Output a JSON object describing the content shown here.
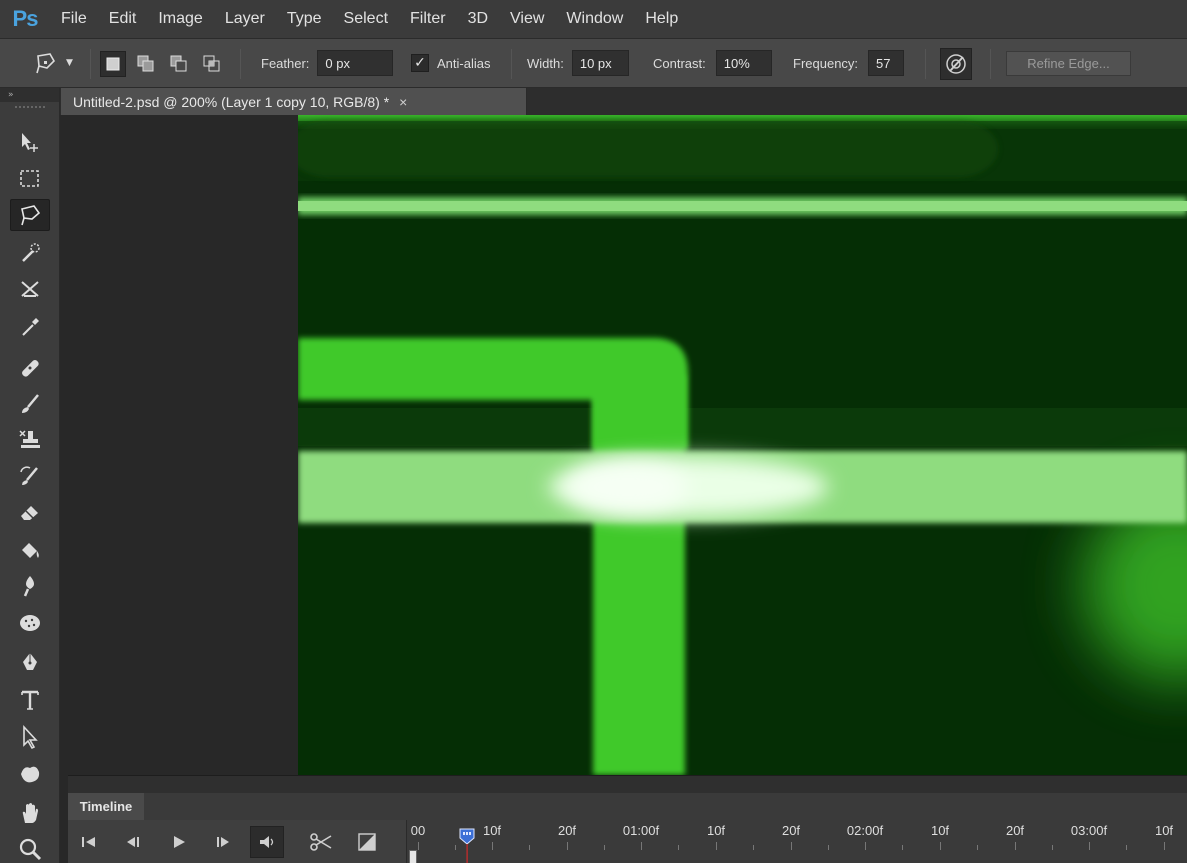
{
  "app": {
    "logo": "Ps"
  },
  "menu": [
    "File",
    "Edit",
    "Image",
    "Layer",
    "Type",
    "Select",
    "Filter",
    "3D",
    "View",
    "Window",
    "Help"
  ],
  "options": {
    "tool_icon": "magnetic-lasso-icon",
    "feather_label": "Feather:",
    "feather_value": "0 px",
    "antialias_label": "Anti-alias",
    "antialias_checked": true,
    "width_label": "Width:",
    "width_value": "10 px",
    "contrast_label": "Contrast:",
    "contrast_value": "10%",
    "frequency_label": "Frequency:",
    "frequency_value": "57",
    "refine_edge_label": "Refine Edge..."
  },
  "toolpanel": {
    "collapse_label": "»"
  },
  "document": {
    "tab_title": "Untitled-2.psd @ 200% (Layer 1 copy 10, RGB/8) *",
    "close_glyph": "×"
  },
  "timeline": {
    "tab_label": "Timeline",
    "ruler_labels": [
      "00",
      "10f",
      "20f",
      "01:00f",
      "10f",
      "20f",
      "02:00f",
      "10f",
      "20f",
      "03:00f",
      "10f"
    ],
    "current_frame": "10f"
  },
  "colors": {
    "canvas_dark_green": "#052e05",
    "bright_green": "#3fc92b",
    "light_green_band": "#8fdc7f",
    "playhead_blue": "#3b6fd6",
    "playhead_red": "#d12a2a"
  }
}
